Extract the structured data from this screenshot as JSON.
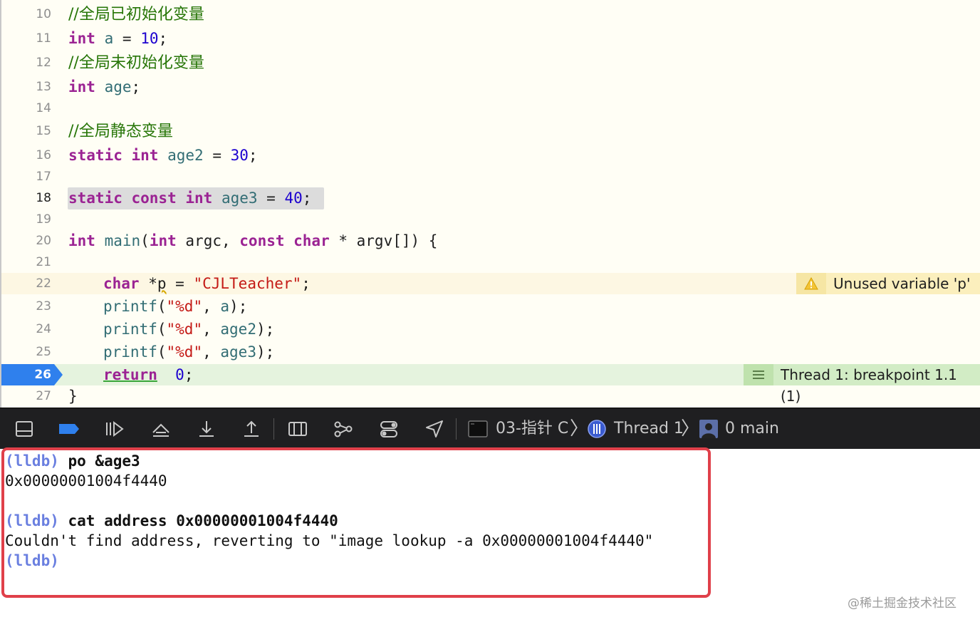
{
  "editor": {
    "lines": [
      {
        "n": "10",
        "comment": "//全局已初始化变量"
      },
      {
        "n": "11",
        "kw": "int",
        "name": "a",
        "op": " = ",
        "num": "10",
        "end": ";"
      },
      {
        "n": "12",
        "comment": "//全局未初始化变量"
      },
      {
        "n": "13",
        "kw": "int",
        "name": "age",
        "end": ";"
      },
      {
        "n": "14"
      },
      {
        "n": "15",
        "comment": "//全局静态变量"
      },
      {
        "n": "16",
        "kw": "static int",
        "name": "age2",
        "op": " = ",
        "num": "30",
        "end": ";"
      },
      {
        "n": "17"
      },
      {
        "n": "18",
        "kw": "static const int",
        "name": "age3",
        "op": " = ",
        "num": "40",
        "end": ";"
      },
      {
        "n": "19"
      },
      {
        "n": "20",
        "kw1": "int",
        "fn": "main",
        "p1": "(",
        "kw2": "int",
        "p2": " argc, ",
        "kw3": "const char",
        "p3": " * argv[]) {"
      },
      {
        "n": "21"
      },
      {
        "n": "22",
        "kw": "char",
        "p1": " *",
        "var": "p",
        "op": " = ",
        "str": "\"CJLTeacher\"",
        "end": ";"
      },
      {
        "n": "23",
        "fn": "printf",
        "p1": "(",
        "str": "\"%d\"",
        "p2": ", ",
        "arg": "a",
        "end": ");"
      },
      {
        "n": "24",
        "fn": "printf",
        "p1": "(",
        "str": "\"%d\"",
        "p2": ", ",
        "arg": "age2",
        "end": ");"
      },
      {
        "n": "25",
        "fn": "printf",
        "p1": "(",
        "str": "\"%d\"",
        "p2": ", ",
        "arg": "age3",
        "end": ");"
      },
      {
        "n": "26",
        "kw": "return",
        "sp": "  ",
        "num": "0",
        "end": ";"
      },
      {
        "n": "27",
        "text": "}"
      }
    ],
    "warning_annotation": "Unused variable 'p'",
    "breakpoint_annotation": "Thread 1: breakpoint 1.1 (1)"
  },
  "debugbar": {
    "target": "03-指针 C",
    "thread": "Thread 1",
    "frame": "0 main"
  },
  "console": {
    "prompt": "(lldb)",
    "cmd1": " po &age3",
    "out1": "0x00000001004f4440",
    "cmd2": " cat address 0x00000001004f4440",
    "out2": "Couldn't find address, reverting to \"image lookup -a 0x00000001004f4440\""
  },
  "watermark": "@稀土掘金技术社区",
  "colors": {
    "keyword": "#9b2393",
    "number": "#1c00cf",
    "string": "#c41a16",
    "comment": "#267507",
    "breakpoint": "#2f80ed",
    "console_frame": "#e0404a"
  }
}
